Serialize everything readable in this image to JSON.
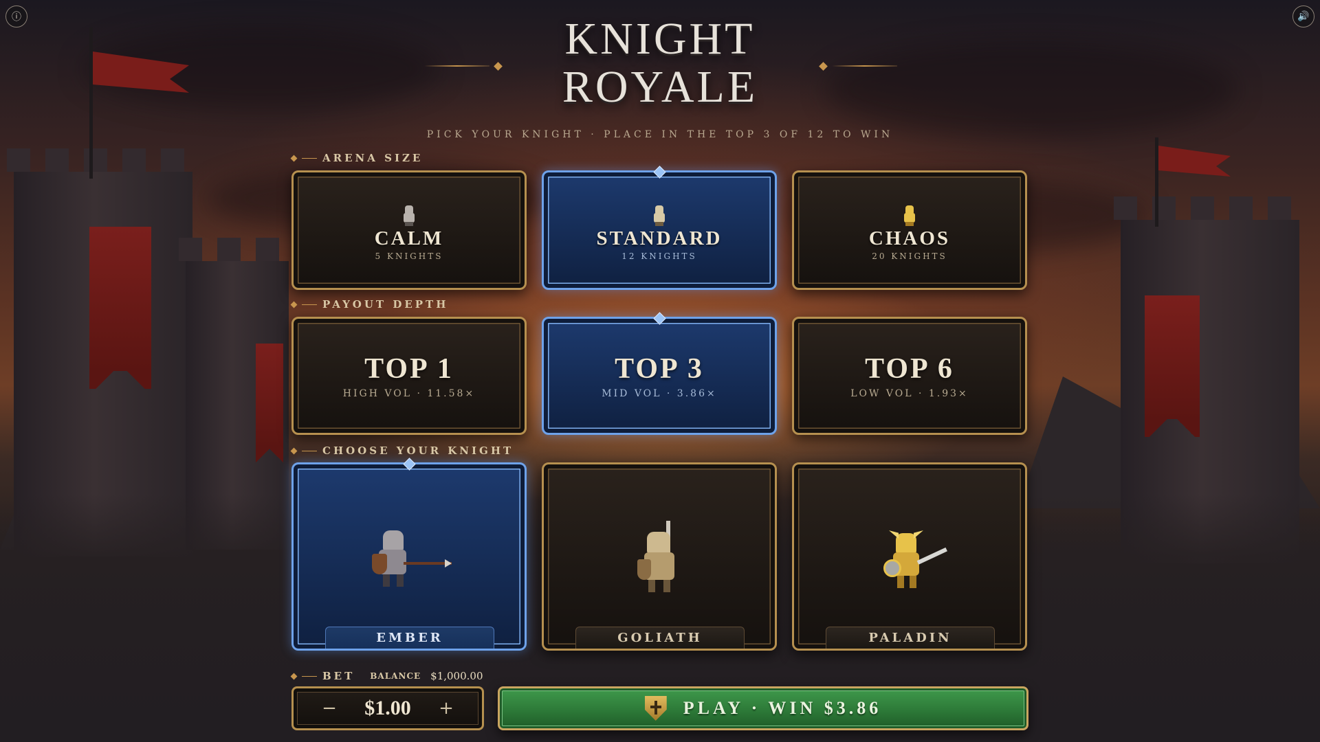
{
  "header": {
    "title_line1": "KNIGHT",
    "title_line2": "ROYALE",
    "subtitle": "PICK YOUR KNIGHT · PLACE IN THE TOP 3 OF 12 TO WIN",
    "info_icon": "info-icon",
    "sound_icon": "speaker-icon"
  },
  "arena": {
    "label": "ARENA SIZE",
    "options": [
      {
        "name": "CALM",
        "sub": "5 KNIGHTS",
        "selected": false
      },
      {
        "name": "STANDARD",
        "sub": "12 KNIGHTS",
        "selected": true
      },
      {
        "name": "CHAOS",
        "sub": "20 KNIGHTS",
        "selected": false
      }
    ]
  },
  "payout": {
    "label": "PAYOUT DEPTH",
    "options": [
      {
        "name": "TOP 1",
        "sub": "HIGH VOL · 11.58×",
        "selected": false
      },
      {
        "name": "TOP 3",
        "sub": "MID VOL · 3.86×",
        "selected": true
      },
      {
        "name": "TOP 6",
        "sub": "LOW VOL · 1.93×",
        "selected": false
      }
    ]
  },
  "knights": {
    "label": "CHOOSE YOUR KNIGHT",
    "options": [
      {
        "name": "EMBER",
        "selected": true
      },
      {
        "name": "GOLIATH",
        "selected": false
      },
      {
        "name": "PALADIN",
        "selected": false
      }
    ]
  },
  "bet": {
    "label": "BET",
    "balance_label": "BALANCE",
    "balance_value": "$1,000.00",
    "amount": "$1.00",
    "minus": "−",
    "plus": "+"
  },
  "play": {
    "label": "PLAY · WIN $3.86",
    "icon": "shield-cross-icon"
  },
  "colors": {
    "gold_border": "#b6904f",
    "selected_blue": "#1d3a6e",
    "play_green": "#2d7a38"
  }
}
